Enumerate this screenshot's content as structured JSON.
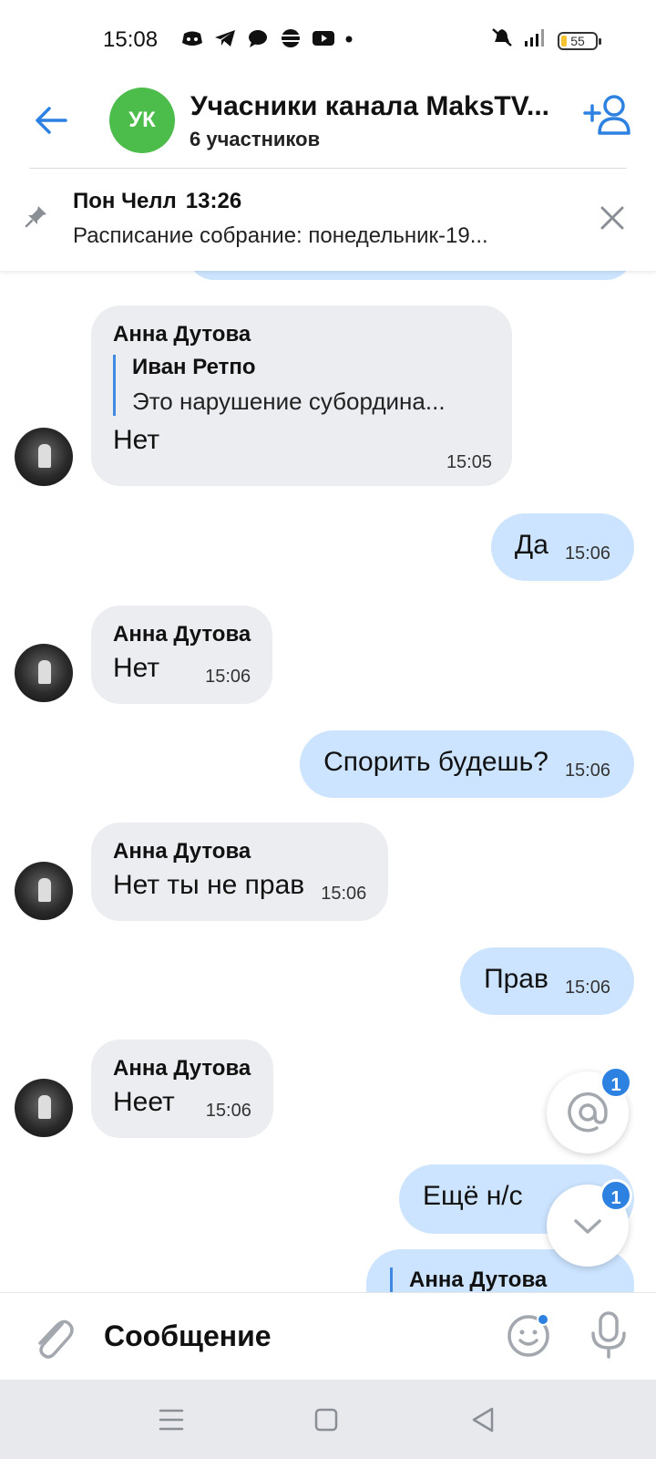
{
  "status_bar": {
    "time": "15:08",
    "battery": "55",
    "network": "4G"
  },
  "header": {
    "avatar_initials": "УК",
    "title": "Учасники канала MaksTV...",
    "subtitle": "6 участников",
    "accent_color": "#2d81e0",
    "avatar_color": "#4cbd4a"
  },
  "pinned": {
    "author": "Пон Челл",
    "time": "13:26",
    "text": "Расписание собрание: понедельник-19..."
  },
  "messages": [
    {
      "direction": "in",
      "author": "Анна Дутова",
      "reply_author": "Иван Ретпо",
      "reply_text": "Это нарушение субордина...",
      "text": "Нет",
      "time": "15:05"
    },
    {
      "direction": "out",
      "text": "Да",
      "time": "15:06"
    },
    {
      "direction": "in",
      "author": "Анна Дутова",
      "text": "Нет",
      "time": "15:06"
    },
    {
      "direction": "out",
      "text": "Спорить будешь?",
      "time": "15:06"
    },
    {
      "direction": "in",
      "author": "Анна Дутова",
      "text": "Нет ты не прав",
      "time": "15:06"
    },
    {
      "direction": "out",
      "text": "Прав",
      "time": "15:06"
    },
    {
      "direction": "in",
      "author": "Анна Дутова",
      "text": "Неет",
      "time": "15:06"
    },
    {
      "direction": "out",
      "text": "Ещё н/с",
      "time": ""
    },
    {
      "direction": "out",
      "reply_author": "Анна Дутова"
    }
  ],
  "fabs": {
    "mentions_badge": "1",
    "scroll_down_badge": "1"
  },
  "composer": {
    "placeholder": "Сообщение"
  },
  "icons": [
    "back-arrow-icon",
    "add-user-icon",
    "pin-icon",
    "close-icon",
    "mention-icon",
    "chevron-down-icon",
    "attach-icon",
    "emoji-icon",
    "mic-icon",
    "menu-icon",
    "home-icon",
    "back-triangle-icon"
  ]
}
